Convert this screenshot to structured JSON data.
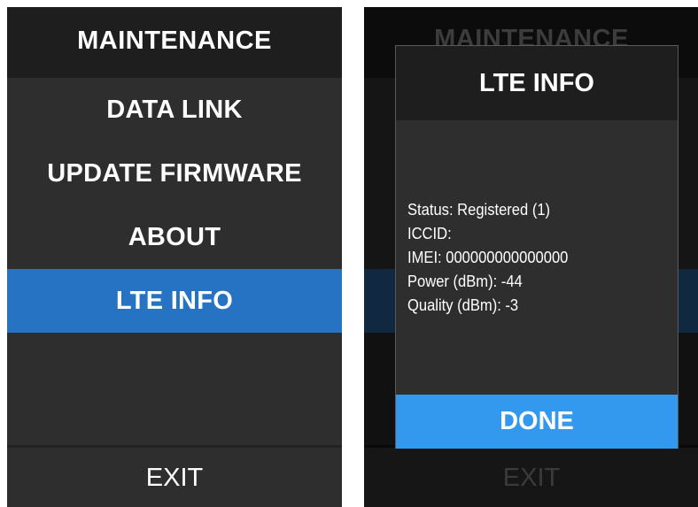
{
  "left_screen": {
    "header": "MAINTENANCE",
    "menu": [
      {
        "label": "DATA LINK",
        "selected": false
      },
      {
        "label": "UPDATE FIRMWARE",
        "selected": false
      },
      {
        "label": "ABOUT",
        "selected": false
      },
      {
        "label": "LTE INFO",
        "selected": true
      }
    ],
    "exit_label": "EXIT"
  },
  "right_screen": {
    "header": "MAINTENANCE",
    "exit_label": "EXIT",
    "dialog": {
      "title": "LTE INFO",
      "lines": [
        "Status: Registered (1)",
        "ICCID:",
        "IMEI: 000000000000000",
        "Power (dBm): -44",
        "Quality (dBm): -3"
      ],
      "done_label": "DONE"
    }
  },
  "colors": {
    "accent_selected": "#2673c4",
    "done_button": "#3399ef",
    "panel": "#2e2e2e",
    "header_bg": "#1e1e1e"
  }
}
